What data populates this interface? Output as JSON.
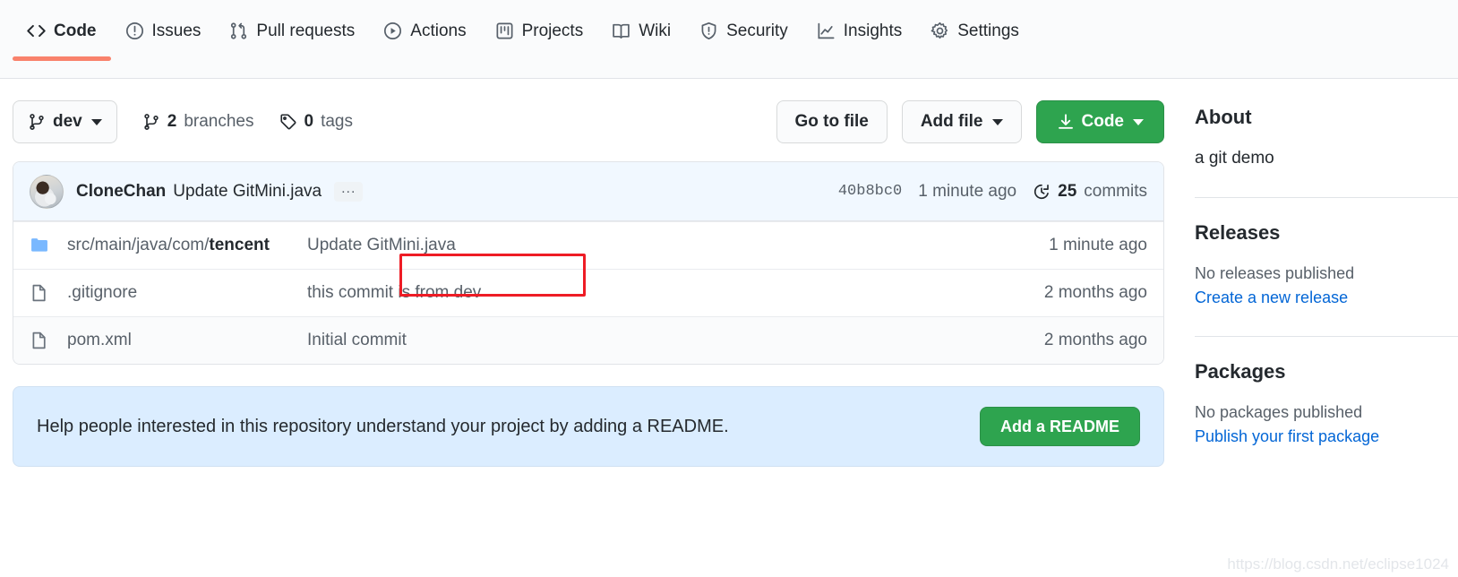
{
  "nav": {
    "tabs": [
      {
        "label": "Code",
        "icon": "code-icon",
        "active": true
      },
      {
        "label": "Issues",
        "icon": "issue-opened-icon",
        "active": false
      },
      {
        "label": "Pull requests",
        "icon": "git-pull-request-icon",
        "active": false
      },
      {
        "label": "Actions",
        "icon": "play-icon",
        "active": false
      },
      {
        "label": "Projects",
        "icon": "project-icon",
        "active": false
      },
      {
        "label": "Wiki",
        "icon": "book-icon",
        "active": false
      },
      {
        "label": "Security",
        "icon": "shield-icon",
        "active": false
      },
      {
        "label": "Insights",
        "icon": "graph-icon",
        "active": false
      },
      {
        "label": "Settings",
        "icon": "gear-icon",
        "active": false
      }
    ]
  },
  "file_actions": {
    "branch_name": "dev",
    "branches_count": "2",
    "branches_label": "branches",
    "tags_count": "0",
    "tags_label": "tags",
    "go_to_file": "Go to file",
    "add_file": "Add file",
    "code": "Code"
  },
  "commit_header": {
    "author": "CloneChan",
    "message": "Update GitMini.java",
    "ellipsis": "...",
    "sha": "40b8bc0",
    "time": "1 minute ago",
    "commits_count": "25",
    "commits_label": "commits"
  },
  "files": [
    {
      "icon": "folder-icon",
      "type": "folder",
      "name_prefix": "src/main/java/com/",
      "name_leaf": "tencent",
      "message": "Update GitMini.java",
      "time": "1 minute ago",
      "highlighted": true
    },
    {
      "icon": "file-icon",
      "type": "file",
      "name_prefix": ".gitignore",
      "name_leaf": "",
      "message": "this commit is from dev",
      "time": "2 months ago",
      "highlighted": false
    },
    {
      "icon": "file-icon",
      "type": "file",
      "name_prefix": "pom.xml",
      "name_leaf": "",
      "message": "Initial commit",
      "time": "2 months ago",
      "highlighted": false
    }
  ],
  "readme_banner": {
    "text": "Help people interested in this repository understand your project by adding a README.",
    "button": "Add a README"
  },
  "sidebar": {
    "about_title": "About",
    "about_description": "a git demo",
    "releases_title": "Releases",
    "releases_empty": "No releases published",
    "releases_link": "Create a new release",
    "packages_title": "Packages",
    "packages_empty": "No packages published",
    "packages_link": "Publish your first package"
  },
  "watermark": "https://blog.csdn.net/eclipse1024",
  "colors": {
    "accent_green": "#2ea44f",
    "active_tab_underline": "#f9826c",
    "link_blue": "#0366d6",
    "folder_blue": "#79b8ff",
    "annotation_red": "#ee1c25",
    "commit_header_bg": "#f1f8ff",
    "banner_bg": "#dbedff"
  }
}
